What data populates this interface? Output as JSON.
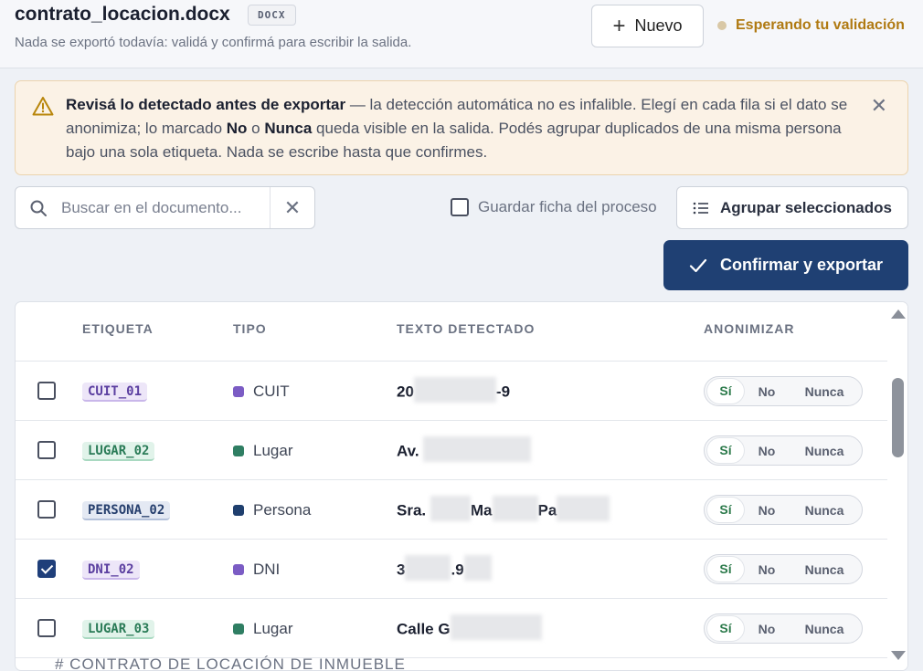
{
  "header": {
    "title": "contrato_locacion.docx",
    "badge": "DOCX",
    "subtitle": "Nada se exportó todavía: validá y confirmá para escribir la salida.",
    "new_button": "Nuevo",
    "status": "Esperando tu validación"
  },
  "alert": {
    "strong": "Revisá lo detectado antes de exportar",
    "part1": " — la detección automática no es infalible. Elegí en cada fila si el dato se anonimiza; lo marcado ",
    "no": "No",
    "or": " o ",
    "never": "Nunca",
    "part2": " queda visible en la salida. Podés agrupar duplicados de una misma persona bajo una sola etiqueta. Nada se escribe hasta que confirmes."
  },
  "toolbar": {
    "search_placeholder": "Buscar en el documento...",
    "save_label": "Guardar ficha del proceso",
    "group_label": "Agrupar seleccionados",
    "confirm_label": "Confirmar y exportar"
  },
  "table": {
    "headers": {
      "tag": "ETIQUETA",
      "type": "TIPO",
      "text": "TEXTO DETECTADO",
      "anon": "ANONIMIZAR"
    },
    "options": {
      "yes": "Sí",
      "no": "No",
      "never": "Nunca"
    },
    "rows": [
      {
        "tag": "CUIT_01",
        "type": "CUIT",
        "text_start": "20",
        "text_end": "-9",
        "checked": false,
        "selected": "Sí",
        "tag_color": "purple",
        "dot_color": "#7b5cc4"
      },
      {
        "tag": "LUGAR_02",
        "type": "Lugar",
        "text_start": "Av.",
        "text_end": "",
        "checked": false,
        "selected": "Sí",
        "tag_color": "green",
        "dot_color": "#2f7e63"
      },
      {
        "tag": "PERSONA_02",
        "type": "Persona",
        "text_start": "Sra.",
        "text_mid": "Ma",
        "text_end": "Pa",
        "checked": false,
        "selected": "Sí",
        "tag_color": "navy",
        "dot_color": "#1f3f6e"
      },
      {
        "tag": "DNI_02",
        "type": "DNI",
        "text_start": "3",
        "text_end": ".9",
        "checked": true,
        "selected": "Sí",
        "tag_color": "purple",
        "dot_color": "#7b5cc4"
      },
      {
        "tag": "LUGAR_03",
        "type": "Lugar",
        "text_start": "Calle G",
        "text_end": "",
        "checked": false,
        "selected": "Sí",
        "tag_color": "green",
        "dot_color": "#2f7e63"
      }
    ]
  },
  "doc_peek": "# CONTRATO DE LOCACIÓN DE INMUEBLE"
}
